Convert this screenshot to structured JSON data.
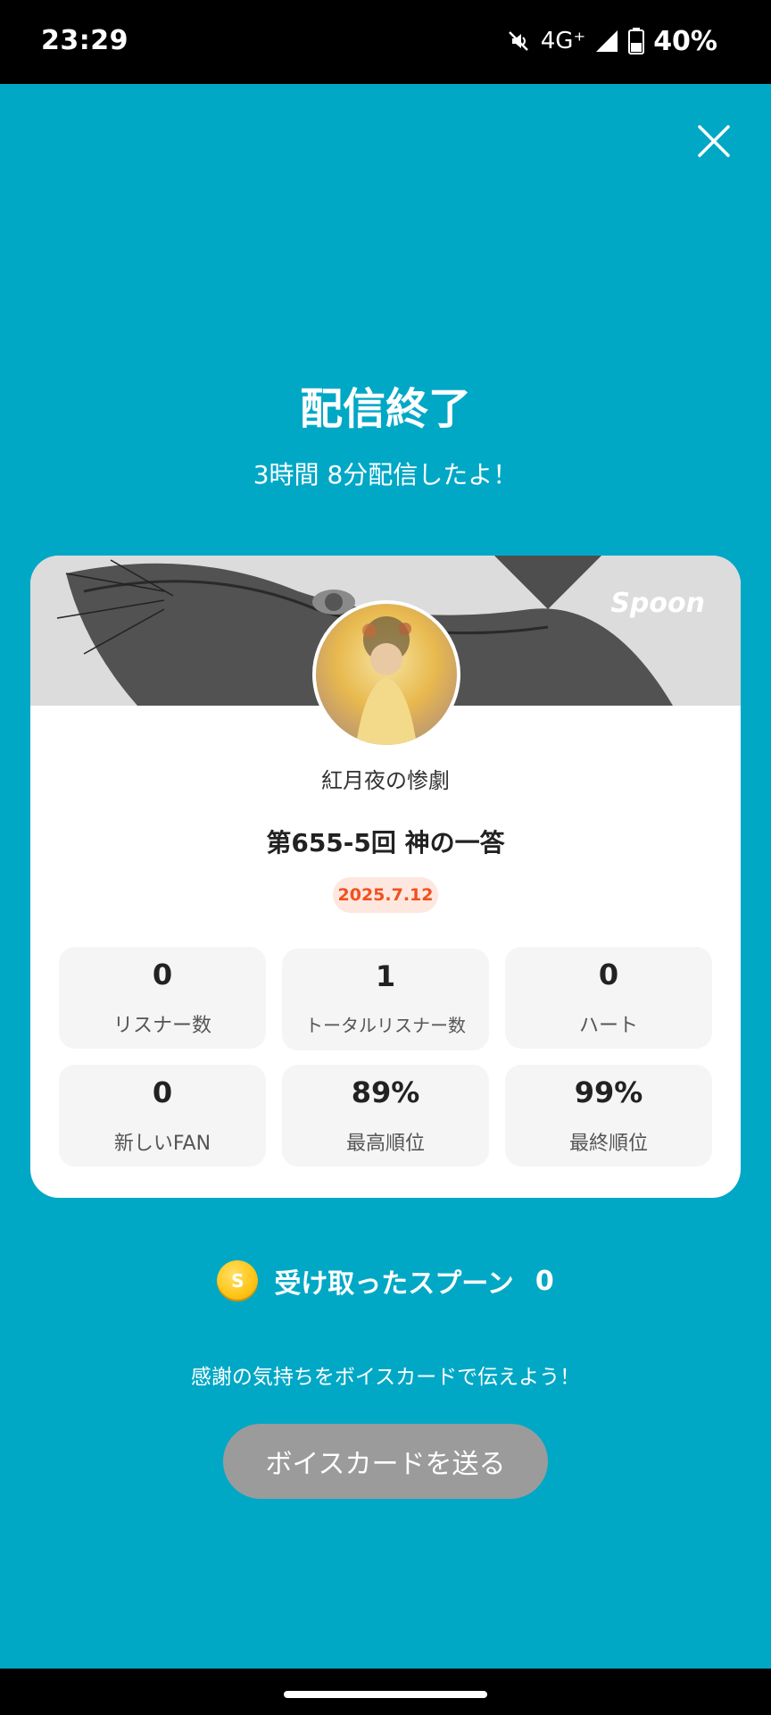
{
  "status_bar": {
    "time": "23:29",
    "network": "4G⁺",
    "battery": "40%",
    "icons": [
      "mute-icon",
      "signal-icon",
      "battery-icon"
    ]
  },
  "title": "配信終了",
  "subtitle": "3時間 8分配信したよ！",
  "card": {
    "brand": "Spoon",
    "dj_name": "紅月夜の惨劇",
    "live_title": "第655-5回 神の一答",
    "date": "2025.7.12",
    "stats": [
      {
        "value": "0",
        "label": "リスナー数"
      },
      {
        "value": "1",
        "label": "トータルリスナー数"
      },
      {
        "value": "0",
        "label": "ハート"
      },
      {
        "value": "0",
        "label": "新しいFAN"
      },
      {
        "value": "89%",
        "label": "最高順位"
      },
      {
        "value": "99%",
        "label": "最終順位"
      }
    ]
  },
  "spoons": {
    "coin_symbol": "S",
    "label": "受け取ったスプーン",
    "count": "0"
  },
  "thanks_text": "感謝の気持ちをボイスカードで伝えよう！",
  "voice_card_button": "ボイスカードを送る",
  "colors": {
    "background": "#00a8c6",
    "date_badge_text": "#f2501f",
    "date_badge_bg": "#fde7de",
    "button_bg": "#9b9b9b"
  }
}
